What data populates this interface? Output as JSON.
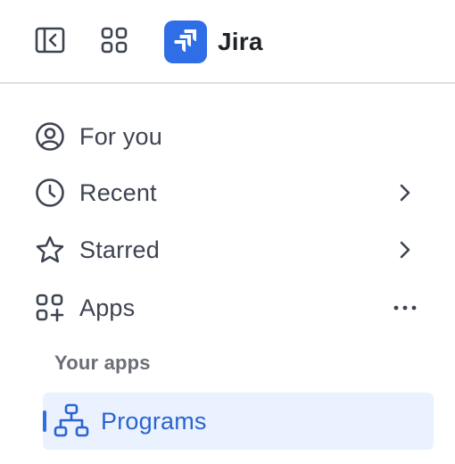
{
  "header": {
    "toggle_icon": "sidebar-collapse-icon",
    "app_switcher_icon": "app-grid-icon",
    "logo_icon": "jira-logo-icon",
    "app_title": "Jira"
  },
  "nav": {
    "items": [
      {
        "label": "For you",
        "icon": "user-circle-icon",
        "trail": null
      },
      {
        "label": "Recent",
        "icon": "clock-icon",
        "trail": "chevron-right-icon"
      },
      {
        "label": "Starred",
        "icon": "star-icon",
        "trail": "chevron-right-icon"
      },
      {
        "label": "Apps",
        "icon": "apps-add-icon",
        "trail": "more-dots-icon"
      }
    ],
    "section_heading": "Your apps",
    "selected_item": {
      "label": "Programs",
      "icon": "hierarchy-icon"
    }
  },
  "colors": {
    "brand": "#2f6ee6",
    "selected_bg": "#e9f2fe",
    "selected_text": "#2c63cf",
    "text": "#3d4350",
    "muted_text": "#6b6e76",
    "divider": "#dcdfe4"
  }
}
